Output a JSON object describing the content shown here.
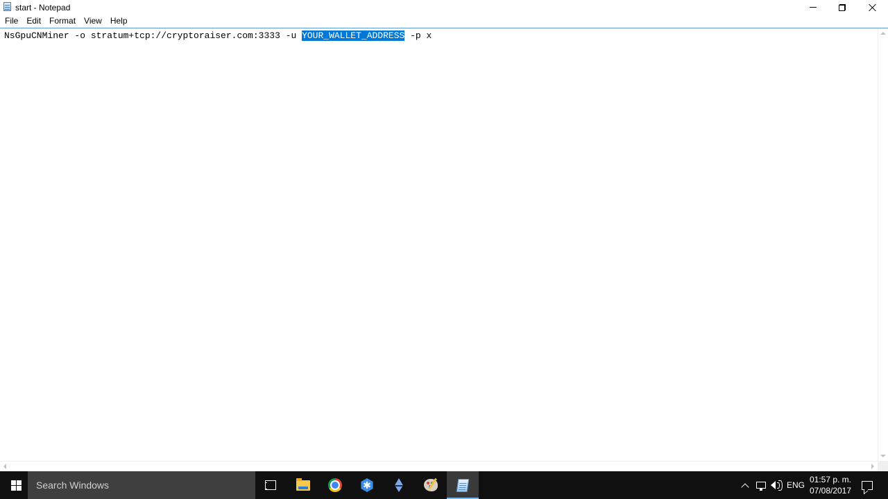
{
  "window": {
    "title": "start - Notepad"
  },
  "menu": {
    "items": [
      "File",
      "Edit",
      "Format",
      "View",
      "Help"
    ]
  },
  "editor": {
    "text_before": "NsGpuCNMiner -o stratum+tcp://cryptoraiser.com:3333 -u ",
    "text_selected": "YOUR_WALLET_ADDRESS",
    "text_after": " -p x",
    "selection_color": "#0078d7"
  },
  "taskbar": {
    "search_placeholder": "Search Windows",
    "pinned_icons": [
      "task-view-icon",
      "file-explorer-icon",
      "chrome-icon",
      "hexagon-app-icon",
      "ethereum-icon",
      "paint-icon",
      "notepad-icon"
    ],
    "active_app": "notepad-icon",
    "language": "ENG",
    "time": "01:57 p. m.",
    "date": "07/08/2017"
  }
}
